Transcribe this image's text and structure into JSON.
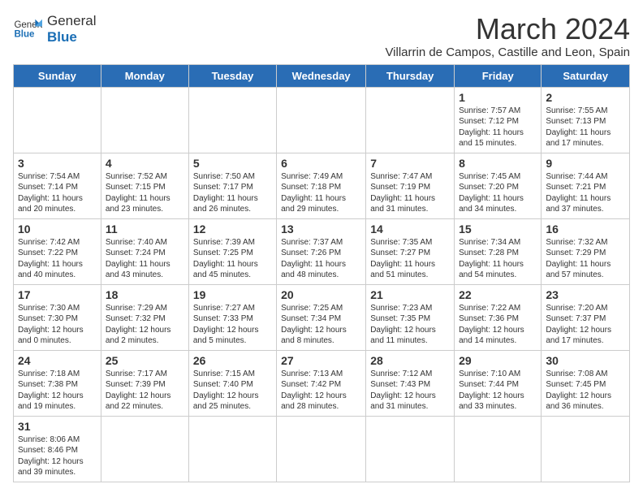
{
  "header": {
    "logo_line1": "General",
    "logo_line2": "Blue",
    "month_year": "March 2024",
    "location": "Villarrin de Campos, Castille and Leon, Spain"
  },
  "weekdays": [
    "Sunday",
    "Monday",
    "Tuesday",
    "Wednesday",
    "Thursday",
    "Friday",
    "Saturday"
  ],
  "weeks": [
    [
      {
        "day": "",
        "info": ""
      },
      {
        "day": "",
        "info": ""
      },
      {
        "day": "",
        "info": ""
      },
      {
        "day": "",
        "info": ""
      },
      {
        "day": "",
        "info": ""
      },
      {
        "day": "1",
        "info": "Sunrise: 7:57 AM\nSunset: 7:12 PM\nDaylight: 11 hours and 15 minutes."
      },
      {
        "day": "2",
        "info": "Sunrise: 7:55 AM\nSunset: 7:13 PM\nDaylight: 11 hours and 17 minutes."
      }
    ],
    [
      {
        "day": "3",
        "info": "Sunrise: 7:54 AM\nSunset: 7:14 PM\nDaylight: 11 hours and 20 minutes."
      },
      {
        "day": "4",
        "info": "Sunrise: 7:52 AM\nSunset: 7:15 PM\nDaylight: 11 hours and 23 minutes."
      },
      {
        "day": "5",
        "info": "Sunrise: 7:50 AM\nSunset: 7:17 PM\nDaylight: 11 hours and 26 minutes."
      },
      {
        "day": "6",
        "info": "Sunrise: 7:49 AM\nSunset: 7:18 PM\nDaylight: 11 hours and 29 minutes."
      },
      {
        "day": "7",
        "info": "Sunrise: 7:47 AM\nSunset: 7:19 PM\nDaylight: 11 hours and 31 minutes."
      },
      {
        "day": "8",
        "info": "Sunrise: 7:45 AM\nSunset: 7:20 PM\nDaylight: 11 hours and 34 minutes."
      },
      {
        "day": "9",
        "info": "Sunrise: 7:44 AM\nSunset: 7:21 PM\nDaylight: 11 hours and 37 minutes."
      }
    ],
    [
      {
        "day": "10",
        "info": "Sunrise: 7:42 AM\nSunset: 7:22 PM\nDaylight: 11 hours and 40 minutes."
      },
      {
        "day": "11",
        "info": "Sunrise: 7:40 AM\nSunset: 7:24 PM\nDaylight: 11 hours and 43 minutes."
      },
      {
        "day": "12",
        "info": "Sunrise: 7:39 AM\nSunset: 7:25 PM\nDaylight: 11 hours and 45 minutes."
      },
      {
        "day": "13",
        "info": "Sunrise: 7:37 AM\nSunset: 7:26 PM\nDaylight: 11 hours and 48 minutes."
      },
      {
        "day": "14",
        "info": "Sunrise: 7:35 AM\nSunset: 7:27 PM\nDaylight: 11 hours and 51 minutes."
      },
      {
        "day": "15",
        "info": "Sunrise: 7:34 AM\nSunset: 7:28 PM\nDaylight: 11 hours and 54 minutes."
      },
      {
        "day": "16",
        "info": "Sunrise: 7:32 AM\nSunset: 7:29 PM\nDaylight: 11 hours and 57 minutes."
      }
    ],
    [
      {
        "day": "17",
        "info": "Sunrise: 7:30 AM\nSunset: 7:30 PM\nDaylight: 12 hours and 0 minutes."
      },
      {
        "day": "18",
        "info": "Sunrise: 7:29 AM\nSunset: 7:32 PM\nDaylight: 12 hours and 2 minutes."
      },
      {
        "day": "19",
        "info": "Sunrise: 7:27 AM\nSunset: 7:33 PM\nDaylight: 12 hours and 5 minutes."
      },
      {
        "day": "20",
        "info": "Sunrise: 7:25 AM\nSunset: 7:34 PM\nDaylight: 12 hours and 8 minutes."
      },
      {
        "day": "21",
        "info": "Sunrise: 7:23 AM\nSunset: 7:35 PM\nDaylight: 12 hours and 11 minutes."
      },
      {
        "day": "22",
        "info": "Sunrise: 7:22 AM\nSunset: 7:36 PM\nDaylight: 12 hours and 14 minutes."
      },
      {
        "day": "23",
        "info": "Sunrise: 7:20 AM\nSunset: 7:37 PM\nDaylight: 12 hours and 17 minutes."
      }
    ],
    [
      {
        "day": "24",
        "info": "Sunrise: 7:18 AM\nSunset: 7:38 PM\nDaylight: 12 hours and 19 minutes."
      },
      {
        "day": "25",
        "info": "Sunrise: 7:17 AM\nSunset: 7:39 PM\nDaylight: 12 hours and 22 minutes."
      },
      {
        "day": "26",
        "info": "Sunrise: 7:15 AM\nSunset: 7:40 PM\nDaylight: 12 hours and 25 minutes."
      },
      {
        "day": "27",
        "info": "Sunrise: 7:13 AM\nSunset: 7:42 PM\nDaylight: 12 hours and 28 minutes."
      },
      {
        "day": "28",
        "info": "Sunrise: 7:12 AM\nSunset: 7:43 PM\nDaylight: 12 hours and 31 minutes."
      },
      {
        "day": "29",
        "info": "Sunrise: 7:10 AM\nSunset: 7:44 PM\nDaylight: 12 hours and 33 minutes."
      },
      {
        "day": "30",
        "info": "Sunrise: 7:08 AM\nSunset: 7:45 PM\nDaylight: 12 hours and 36 minutes."
      }
    ],
    [
      {
        "day": "31",
        "info": "Sunrise: 8:06 AM\nSunset: 8:46 PM\nDaylight: 12 hours and 39 minutes."
      },
      {
        "day": "",
        "info": ""
      },
      {
        "day": "",
        "info": ""
      },
      {
        "day": "",
        "info": ""
      },
      {
        "day": "",
        "info": ""
      },
      {
        "day": "",
        "info": ""
      },
      {
        "day": "",
        "info": ""
      }
    ]
  ]
}
